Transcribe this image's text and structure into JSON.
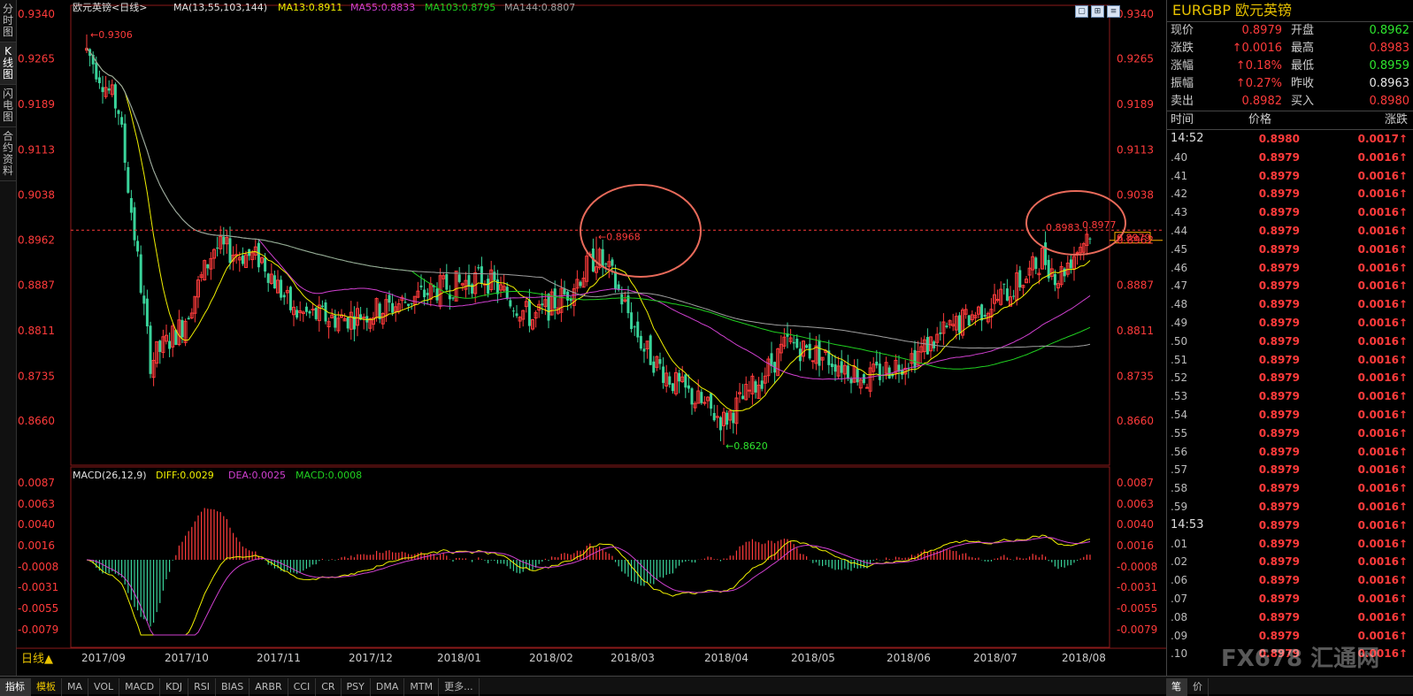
{
  "sidebar": {
    "tabs": [
      {
        "label": "分时图"
      },
      {
        "label": "K线图"
      },
      {
        "label": "闪电图"
      },
      {
        "label": "合约资料"
      }
    ]
  },
  "header": {
    "name": "欧元英镑<日线>",
    "ma_params": "MA(13,55,103,144)",
    "ma13": "MA13:0.8911",
    "ma55": "MA55:0.8833",
    "ma103": "MA103:0.8795",
    "ma144": "MA144:0.8807"
  },
  "macd_header": {
    "params": "MACD(26,12,9)",
    "diff": "DIFF:0.0029",
    "dea": "DEA:0.0025",
    "macd": "MACD:0.0008"
  },
  "axis": {
    "price_ticks": [
      "0.9340",
      "0.9265",
      "0.9189",
      "0.9113",
      "0.9038",
      "0.8962",
      "0.8887",
      "0.8811",
      "0.8735",
      "0.8660"
    ],
    "macd_ticks": [
      "0.0087",
      "0.0063",
      "0.0040",
      "0.0016",
      "-0.0008",
      "-0.0031",
      "-0.0055",
      "-0.0079"
    ],
    "months": [
      "2017/09",
      "2017/10",
      "2017/11",
      "2017/12",
      "2018/01",
      "2018/02",
      "2018/03",
      "2018/04",
      "2018/05",
      "2018/06",
      "2018/07",
      "2018/08"
    ]
  },
  "annotations": {
    "high_label": "0.9306",
    "low_label": "0.8620",
    "mar_high": "0.8968",
    "recent_high_a": "0.8983",
    "recent_high_b": "0.8977",
    "last_price": "0.8979"
  },
  "colors": {
    "up": "#ff3b3b",
    "down": "#39d39a",
    "ma13": "#f0f000",
    "ma55": "#d040d0",
    "ma103": "#20d020",
    "ma144": "#a0a0a0",
    "dea": "#d040d0",
    "diff": "#f0f000",
    "circle": "#e86a5a"
  },
  "chart_data": {
    "type": "candlestick",
    "title": "欧元英镑 日线",
    "ylim": [
      0.86,
      0.934
    ],
    "months": [
      "2017/09",
      "2017/10",
      "2017/11",
      "2017/12",
      "2018/01",
      "2018/02",
      "2018/03",
      "2018/04",
      "2018/05",
      "2018/06",
      "2018/07",
      "2018/08"
    ],
    "close_monthly_approx": [
      0.919,
      0.886,
      0.884,
      0.888,
      0.887,
      0.888,
      0.885,
      0.872,
      0.877,
      0.879,
      0.888,
      0.8979
    ],
    "high": 0.9306,
    "low": 0.862,
    "series": [
      {
        "name": "MA13",
        "last": 0.8911
      },
      {
        "name": "MA55",
        "last": 0.8833
      },
      {
        "name": "MA103",
        "last": 0.8795
      },
      {
        "name": "MA144",
        "last": 0.8807
      }
    ],
    "macd": {
      "DIFF": 0.0029,
      "DEA": 0.0025,
      "MACD": 0.0008,
      "ylim": [
        -0.009,
        0.009
      ]
    }
  },
  "right_panel": {
    "title": "EURGBP 欧元英镑",
    "quote": [
      {
        "l": "现价",
        "lv": "0.8979",
        "lc": "red",
        "r": "开盘",
        "rv": "0.8962",
        "rc": "green"
      },
      {
        "l": "涨跌",
        "lv": "↑0.0016",
        "lc": "red",
        "r": "最高",
        "rv": "0.8983",
        "rc": "red"
      },
      {
        "l": "涨幅",
        "lv": "↑0.18%",
        "lc": "red",
        "r": "最低",
        "rv": "0.8959",
        "rc": "green"
      },
      {
        "l": "振幅",
        "lv": "↑0.27%",
        "lc": "red",
        "r": "昨收",
        "rv": "0.8963",
        "rc": "white"
      },
      {
        "l": "卖出",
        "lv": "0.8982",
        "lc": "red",
        "r": "买入",
        "rv": "0.8980",
        "rc": "red"
      }
    ],
    "tick_headers": {
      "time": "时间",
      "price": "价格",
      "change": "涨跌"
    },
    "ticks": [
      {
        "t": "14:52",
        "p": "0.8980",
        "c": "0.0017↑",
        "big": true
      },
      {
        "t": ".40",
        "p": "0.8979",
        "c": "0.0016↑"
      },
      {
        "t": ".41",
        "p": "0.8979",
        "c": "0.0016↑"
      },
      {
        "t": ".42",
        "p": "0.8979",
        "c": "0.0016↑"
      },
      {
        "t": ".43",
        "p": "0.8979",
        "c": "0.0016↑"
      },
      {
        "t": ".44",
        "p": "0.8979",
        "c": "0.0016↑"
      },
      {
        "t": ".45",
        "p": "0.8979",
        "c": "0.0016↑"
      },
      {
        "t": ".46",
        "p": "0.8979",
        "c": "0.0016↑"
      },
      {
        "t": ".47",
        "p": "0.8979",
        "c": "0.0016↑"
      },
      {
        "t": ".48",
        "p": "0.8979",
        "c": "0.0016↑"
      },
      {
        "t": ".49",
        "p": "0.8979",
        "c": "0.0016↑"
      },
      {
        "t": ".50",
        "p": "0.8979",
        "c": "0.0016↑"
      },
      {
        "t": ".51",
        "p": "0.8979",
        "c": "0.0016↑"
      },
      {
        "t": ".52",
        "p": "0.8979",
        "c": "0.0016↑"
      },
      {
        "t": ".53",
        "p": "0.8979",
        "c": "0.0016↑"
      },
      {
        "t": ".54",
        "p": "0.8979",
        "c": "0.0016↑"
      },
      {
        "t": ".55",
        "p": "0.8979",
        "c": "0.0016↑"
      },
      {
        "t": ".56",
        "p": "0.8979",
        "c": "0.0016↑"
      },
      {
        "t": ".57",
        "p": "0.8979",
        "c": "0.0016↑"
      },
      {
        "t": ".58",
        "p": "0.8979",
        "c": "0.0016↑"
      },
      {
        "t": ".59",
        "p": "0.8979",
        "c": "0.0016↑"
      },
      {
        "t": "14:53",
        "p": "0.8979",
        "c": "0.0016↑",
        "big": true
      },
      {
        "t": ".01",
        "p": "0.8979",
        "c": "0.0016↑"
      },
      {
        "t": ".02",
        "p": "0.8979",
        "c": "0.0016↑"
      },
      {
        "t": ".06",
        "p": "0.8979",
        "c": "0.0016↑"
      },
      {
        "t": ".07",
        "p": "0.8979",
        "c": "0.0016↑"
      },
      {
        "t": ".08",
        "p": "0.8979",
        "c": "0.0016↑"
      },
      {
        "t": ".09",
        "p": "0.8979",
        "c": "0.0016↑"
      },
      {
        "t": ".10",
        "p": "0.8979",
        "c": "0.0016↑"
      }
    ]
  },
  "bottom": {
    "period_label": "日线▲",
    "tabs": [
      "指标",
      "模板",
      "MA",
      "VOL",
      "MACD",
      "KDJ",
      "RSI",
      "BIAS",
      "ARBR",
      "CCI",
      "CR",
      "PSY",
      "DMA",
      "MTM",
      "更多..."
    ],
    "right_tabs": [
      "笔",
      "价"
    ]
  },
  "watermark": "FX678 汇通网"
}
